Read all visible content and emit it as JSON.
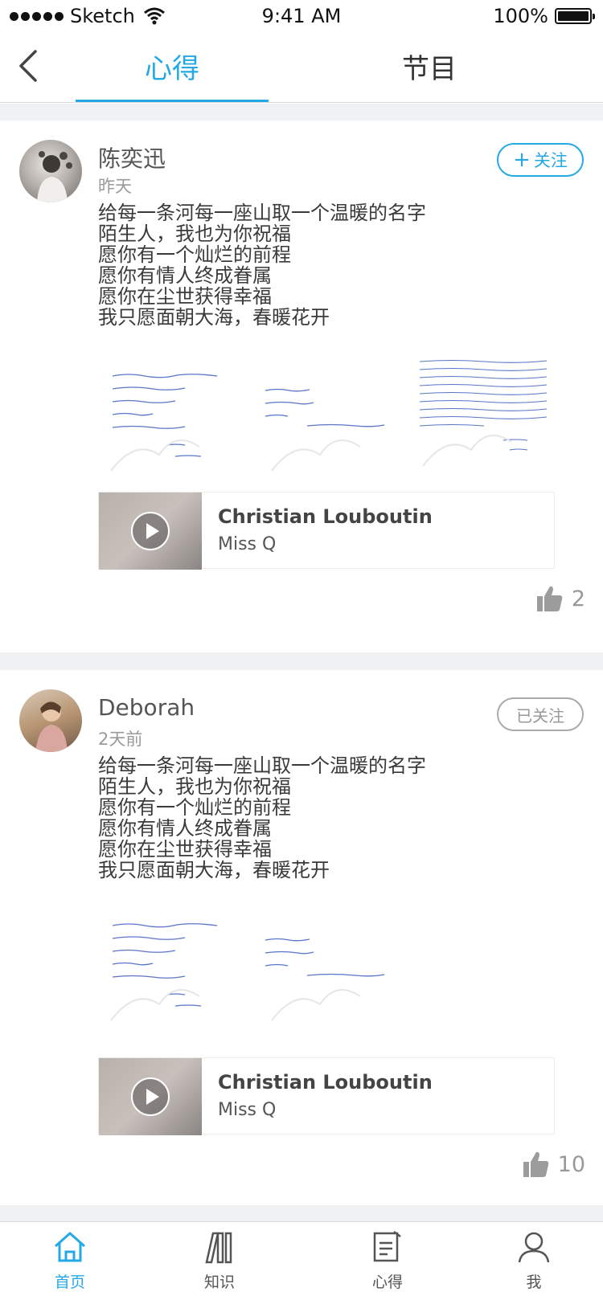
{
  "status_bar": {
    "carrier": "Sketch",
    "time": "9:41 AM",
    "battery": "100%"
  },
  "nav": {
    "tabs": [
      "心得",
      "节目"
    ],
    "active_tab": "心得"
  },
  "posts": [
    {
      "username": "陈奕迅",
      "time": "昨天",
      "follow_label": "关注",
      "lines": [
        "给每一条河每一座山取一个温暖的名字",
        "陌生人，我也为你祝福",
        "愿你有一个灿烂的前程",
        "愿你有情人终成眷属",
        "愿你在尘世获得幸福",
        "我只愿面朝大海，春暖花开"
      ],
      "media": {
        "title": "Christian Louboutin",
        "subtitle": "Miss Q"
      },
      "likes": "2"
    },
    {
      "username": "Deborah",
      "time": "2天前",
      "follow_label": "已关注",
      "lines": [
        "给每一条河每一座山取一个温暖的名字",
        "陌生人，我也为你祝福",
        "愿你有一个灿烂的前程",
        "愿你有情人终成眷属",
        "愿你在尘世获得幸福",
        "我只愿面朝大海，春暖花开"
      ],
      "media": {
        "title": "Christian Louboutin",
        "subtitle": "Miss Q"
      },
      "likes": "10"
    }
  ],
  "tabbar": {
    "items": [
      "首页",
      "知识",
      "心得",
      "我"
    ],
    "active": "首页"
  },
  "colors": {
    "accent": "#24a8e6",
    "separator": "#f0f1f3",
    "text": "#3a3a3a",
    "muted": "#9a9a9a"
  },
  "icons": [
    "back-chevron-icon",
    "wifi-icon",
    "battery-icon",
    "play-icon",
    "thumbs-up-icon",
    "home-icon",
    "books-icon",
    "note-edit-icon",
    "person-icon"
  ]
}
